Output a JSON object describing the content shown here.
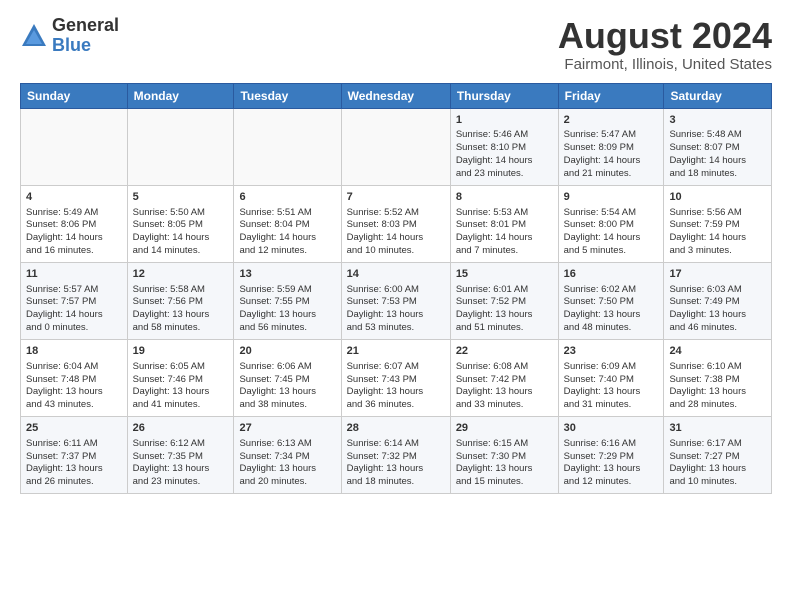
{
  "logo": {
    "general": "General",
    "blue": "Blue"
  },
  "title": "August 2024",
  "subtitle": "Fairmont, Illinois, United States",
  "days_header": [
    "Sunday",
    "Monday",
    "Tuesday",
    "Wednesday",
    "Thursday",
    "Friday",
    "Saturday"
  ],
  "weeks": [
    [
      {
        "day": "",
        "info": ""
      },
      {
        "day": "",
        "info": ""
      },
      {
        "day": "",
        "info": ""
      },
      {
        "day": "",
        "info": ""
      },
      {
        "day": "1",
        "info": "Sunrise: 5:46 AM\nSunset: 8:10 PM\nDaylight: 14 hours\nand 23 minutes."
      },
      {
        "day": "2",
        "info": "Sunrise: 5:47 AM\nSunset: 8:09 PM\nDaylight: 14 hours\nand 21 minutes."
      },
      {
        "day": "3",
        "info": "Sunrise: 5:48 AM\nSunset: 8:07 PM\nDaylight: 14 hours\nand 18 minutes."
      }
    ],
    [
      {
        "day": "4",
        "info": "Sunrise: 5:49 AM\nSunset: 8:06 PM\nDaylight: 14 hours\nand 16 minutes."
      },
      {
        "day": "5",
        "info": "Sunrise: 5:50 AM\nSunset: 8:05 PM\nDaylight: 14 hours\nand 14 minutes."
      },
      {
        "day": "6",
        "info": "Sunrise: 5:51 AM\nSunset: 8:04 PM\nDaylight: 14 hours\nand 12 minutes."
      },
      {
        "day": "7",
        "info": "Sunrise: 5:52 AM\nSunset: 8:03 PM\nDaylight: 14 hours\nand 10 minutes."
      },
      {
        "day": "8",
        "info": "Sunrise: 5:53 AM\nSunset: 8:01 PM\nDaylight: 14 hours\nand 7 minutes."
      },
      {
        "day": "9",
        "info": "Sunrise: 5:54 AM\nSunset: 8:00 PM\nDaylight: 14 hours\nand 5 minutes."
      },
      {
        "day": "10",
        "info": "Sunrise: 5:56 AM\nSunset: 7:59 PM\nDaylight: 14 hours\nand 3 minutes."
      }
    ],
    [
      {
        "day": "11",
        "info": "Sunrise: 5:57 AM\nSunset: 7:57 PM\nDaylight: 14 hours\nand 0 minutes."
      },
      {
        "day": "12",
        "info": "Sunrise: 5:58 AM\nSunset: 7:56 PM\nDaylight: 13 hours\nand 58 minutes."
      },
      {
        "day": "13",
        "info": "Sunrise: 5:59 AM\nSunset: 7:55 PM\nDaylight: 13 hours\nand 56 minutes."
      },
      {
        "day": "14",
        "info": "Sunrise: 6:00 AM\nSunset: 7:53 PM\nDaylight: 13 hours\nand 53 minutes."
      },
      {
        "day": "15",
        "info": "Sunrise: 6:01 AM\nSunset: 7:52 PM\nDaylight: 13 hours\nand 51 minutes."
      },
      {
        "day": "16",
        "info": "Sunrise: 6:02 AM\nSunset: 7:50 PM\nDaylight: 13 hours\nand 48 minutes."
      },
      {
        "day": "17",
        "info": "Sunrise: 6:03 AM\nSunset: 7:49 PM\nDaylight: 13 hours\nand 46 minutes."
      }
    ],
    [
      {
        "day": "18",
        "info": "Sunrise: 6:04 AM\nSunset: 7:48 PM\nDaylight: 13 hours\nand 43 minutes."
      },
      {
        "day": "19",
        "info": "Sunrise: 6:05 AM\nSunset: 7:46 PM\nDaylight: 13 hours\nand 41 minutes."
      },
      {
        "day": "20",
        "info": "Sunrise: 6:06 AM\nSunset: 7:45 PM\nDaylight: 13 hours\nand 38 minutes."
      },
      {
        "day": "21",
        "info": "Sunrise: 6:07 AM\nSunset: 7:43 PM\nDaylight: 13 hours\nand 36 minutes."
      },
      {
        "day": "22",
        "info": "Sunrise: 6:08 AM\nSunset: 7:42 PM\nDaylight: 13 hours\nand 33 minutes."
      },
      {
        "day": "23",
        "info": "Sunrise: 6:09 AM\nSunset: 7:40 PM\nDaylight: 13 hours\nand 31 minutes."
      },
      {
        "day": "24",
        "info": "Sunrise: 6:10 AM\nSunset: 7:38 PM\nDaylight: 13 hours\nand 28 minutes."
      }
    ],
    [
      {
        "day": "25",
        "info": "Sunrise: 6:11 AM\nSunset: 7:37 PM\nDaylight: 13 hours\nand 26 minutes."
      },
      {
        "day": "26",
        "info": "Sunrise: 6:12 AM\nSunset: 7:35 PM\nDaylight: 13 hours\nand 23 minutes."
      },
      {
        "day": "27",
        "info": "Sunrise: 6:13 AM\nSunset: 7:34 PM\nDaylight: 13 hours\nand 20 minutes."
      },
      {
        "day": "28",
        "info": "Sunrise: 6:14 AM\nSunset: 7:32 PM\nDaylight: 13 hours\nand 18 minutes."
      },
      {
        "day": "29",
        "info": "Sunrise: 6:15 AM\nSunset: 7:30 PM\nDaylight: 13 hours\nand 15 minutes."
      },
      {
        "day": "30",
        "info": "Sunrise: 6:16 AM\nSunset: 7:29 PM\nDaylight: 13 hours\nand 12 minutes."
      },
      {
        "day": "31",
        "info": "Sunrise: 6:17 AM\nSunset: 7:27 PM\nDaylight: 13 hours\nand 10 minutes."
      }
    ]
  ]
}
